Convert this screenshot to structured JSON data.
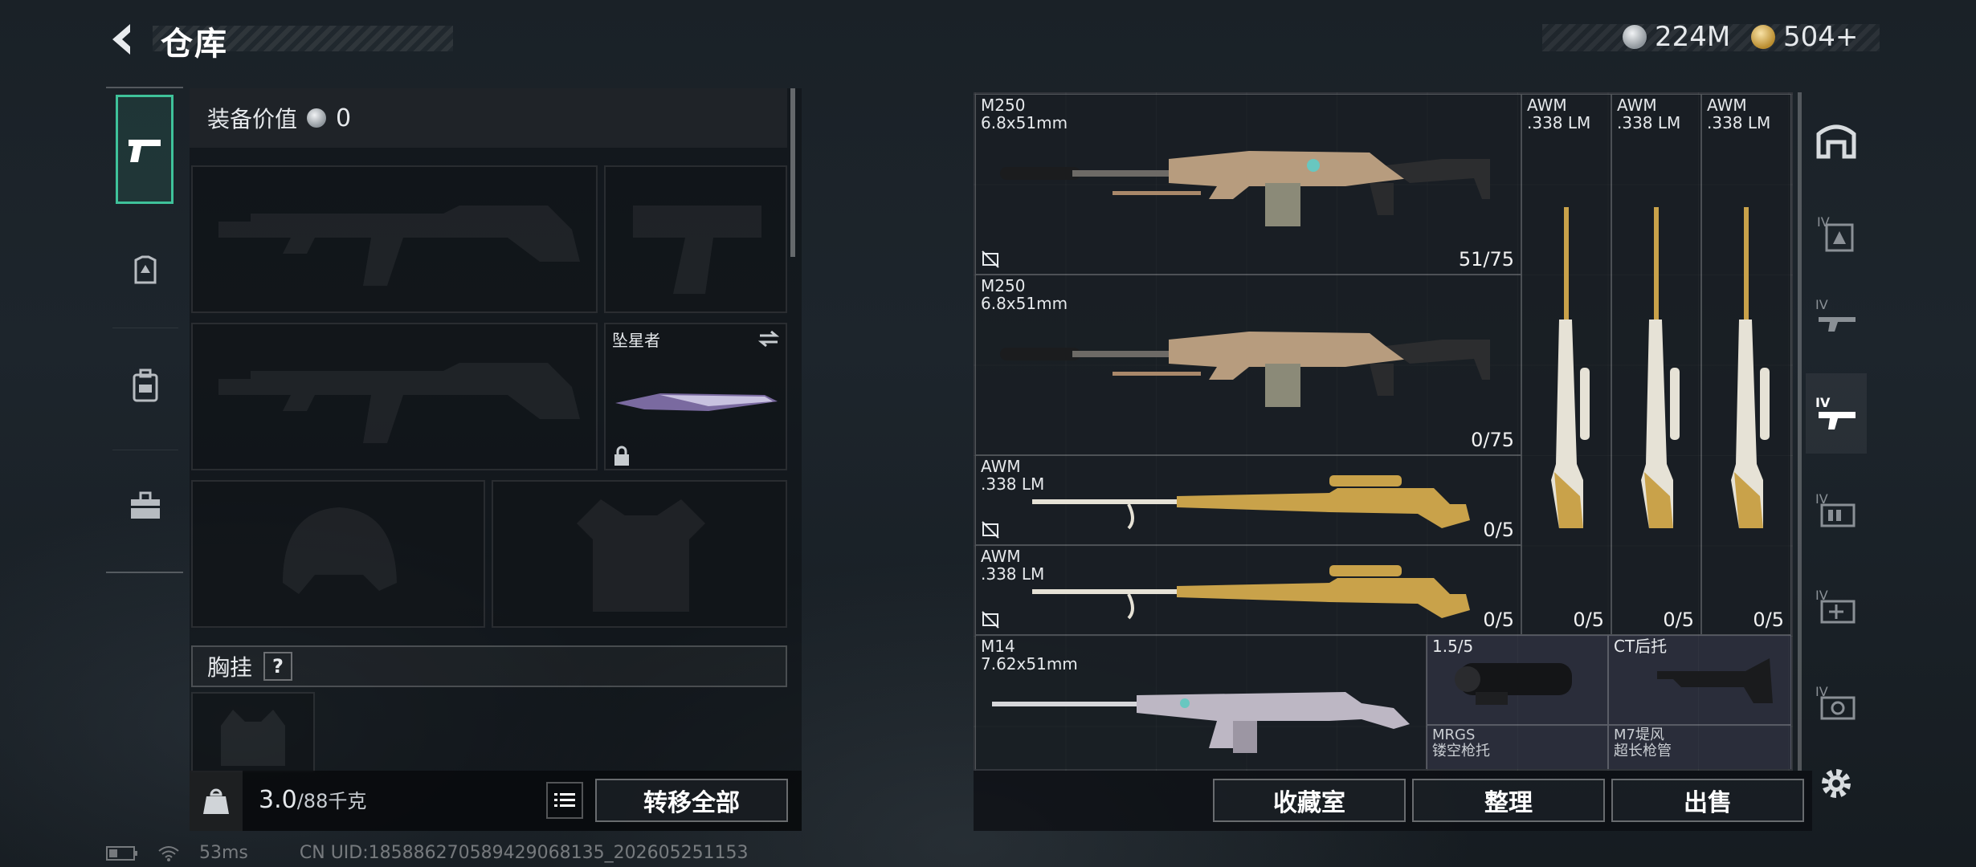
{
  "header": {
    "title": "仓库"
  },
  "currency": [
    {
      "amount": "224M",
      "icon": "silver-coin-icon",
      "color": "#c9cdd1"
    },
    {
      "amount": "504+",
      "icon": "gold-coin-icon",
      "color": "#d9b25a"
    }
  ],
  "equipment": {
    "value_label": "装备价值",
    "value": "0",
    "melee_name": "坠星者",
    "chest_rig_label": "胸挂",
    "chest_rig_help": "?",
    "weight_value": "3.0",
    "weight_max": "/88千克",
    "transfer_all": "转移全部"
  },
  "stash": {
    "items": [
      {
        "name": "M250\n6.8x51mm",
        "count": "51/75"
      },
      {
        "name": "M250\n6.8x51mm",
        "count": "0/75"
      },
      {
        "name": "AWM\n.338 LM",
        "count": "0/5"
      },
      {
        "name": "AWM\n.338 LM",
        "count": "0/5"
      },
      {
        "name": "AWM\n.338 LM",
        "count": "0/5"
      },
      {
        "name": "AWM\n.338 LM",
        "count": "0/5"
      },
      {
        "name": "AWM\n.338 LM",
        "count": "0/5"
      },
      {
        "name": "M14\n7.62x51mm",
        "count": ""
      },
      {
        "name": "1.5/5",
        "count": ""
      },
      {
        "name": "CT后托",
        "count": ""
      },
      {
        "name": "MRGS\n镂空枪托",
        "count": ""
      },
      {
        "name": "M7堤风\n超长枪管",
        "count": ""
      }
    ]
  },
  "actions": {
    "collection": "收藏室",
    "sort": "整理",
    "sell": "出售"
  },
  "footer": {
    "ping": "53ms",
    "uid": "CN UID:18588627058942906813​5_202605251153"
  },
  "colors": {
    "accent": "#3fc29a",
    "gold": "#c9a24a"
  }
}
